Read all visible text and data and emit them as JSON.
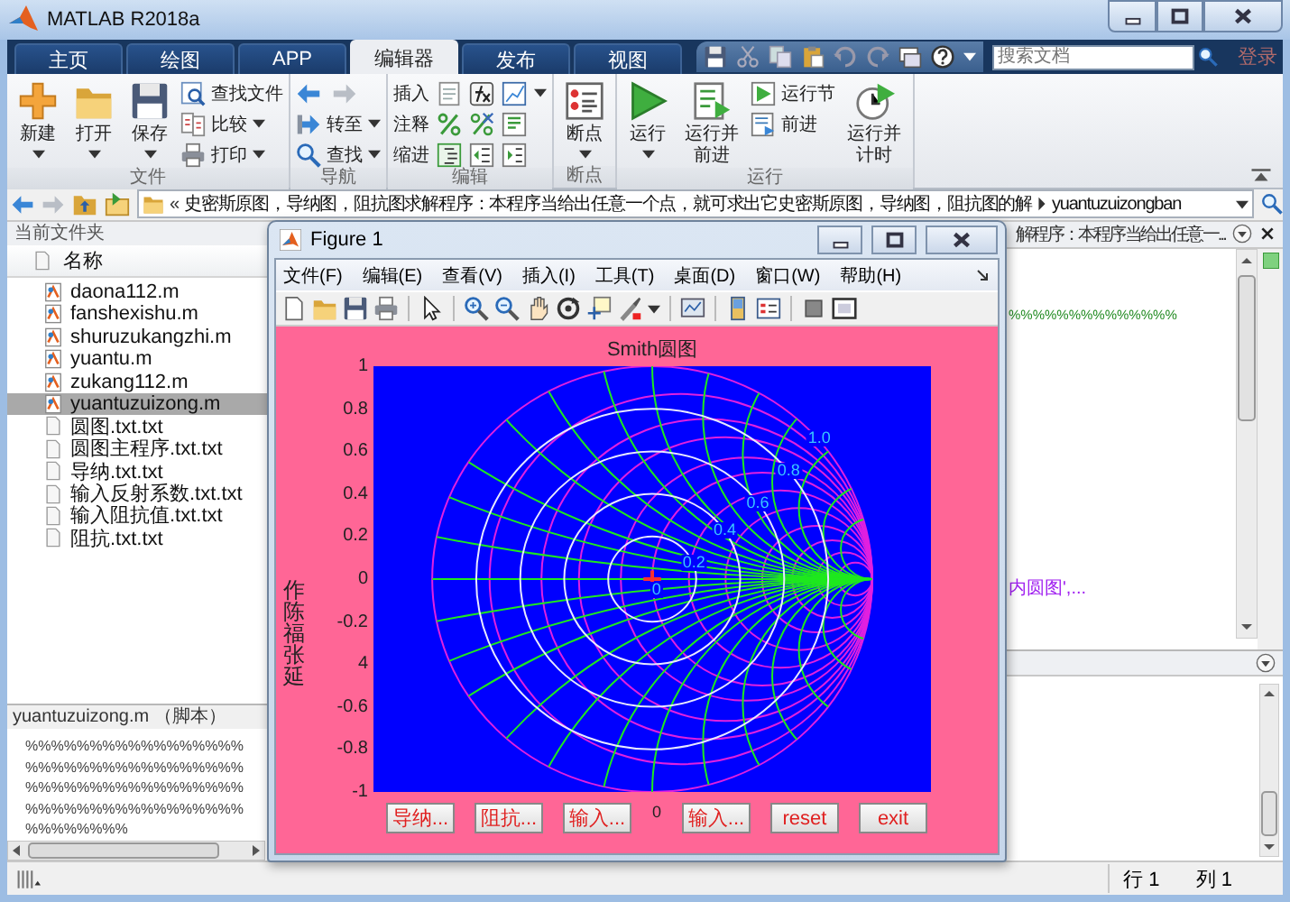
{
  "window": {
    "title": "MATLAB R2018a"
  },
  "tabs": [
    {
      "label": "主页",
      "selected": false
    },
    {
      "label": "绘图",
      "selected": false
    },
    {
      "label": "APP",
      "selected": false
    },
    {
      "label": "编辑器",
      "selected": true
    },
    {
      "label": "发布",
      "selected": false
    },
    {
      "label": "视图",
      "selected": false
    }
  ],
  "search": {
    "placeholder": "搜索文档"
  },
  "sign_in": "登录",
  "ribbon": {
    "groups": [
      {
        "label": "文件",
        "items": [
          {
            "kind": "large",
            "label": "新建",
            "dropdown": true
          },
          {
            "kind": "large",
            "label": "打开",
            "dropdown": true
          },
          {
            "kind": "large",
            "label": "保存",
            "dropdown": true
          },
          {
            "kind": "stack",
            "buttons": [
              {
                "kind": "small",
                "label": "查找文件",
                "dropdown": false
              },
              {
                "kind": "small",
                "label": "比较",
                "dropdown": true
              },
              {
                "kind": "small",
                "label": "打印",
                "dropdown": true
              }
            ]
          }
        ]
      },
      {
        "label": "导航",
        "items": [
          {
            "kind": "stack",
            "buttons": [
              {
                "kind": "arrows"
              },
              {
                "kind": "small",
                "label": "转至",
                "dropdown": true
              },
              {
                "kind": "small",
                "label": "查找",
                "dropdown": true
              }
            ]
          }
        ]
      },
      {
        "label": "编辑",
        "items": [
          {
            "kind": "stack",
            "buttons": [
              {
                "kind": "tools",
                "label": "插入"
              },
              {
                "kind": "tools",
                "label": "注释"
              },
              {
                "kind": "tools",
                "label": "缩进"
              }
            ]
          }
        ]
      },
      {
        "label": "断点",
        "items": [
          {
            "kind": "large",
            "label": "断点",
            "dropdown": true
          }
        ]
      },
      {
        "label": "运行",
        "items": [
          {
            "kind": "large",
            "label": "运行",
            "dropdown": true
          },
          {
            "kind": "large",
            "label": "运行并前进",
            "dropdown": false
          },
          {
            "kind": "stack",
            "buttons": [
              {
                "kind": "small",
                "label": "运行节",
                "dropdown": false
              },
              {
                "kind": "small",
                "label": "前进",
                "dropdown": false
              }
            ]
          },
          {
            "kind": "large",
            "label": "运行并计时",
            "dropdown": false
          }
        ]
      }
    ]
  },
  "address_bar": {
    "prefix": "«",
    "path": "史密斯原图，导纳图，阻抗图求解程序：本程序当给出任意一个点，就可求出它史密斯原图，导纳图，阻抗图的解",
    "folder": "yuantuzuizongban"
  },
  "current_folder": {
    "title": "当前文件夹",
    "column": "名称",
    "files": [
      {
        "name": "daona112.m",
        "kind": "m",
        "selected": false
      },
      {
        "name": "fanshexishu.m",
        "kind": "m",
        "selected": false
      },
      {
        "name": "shuruzukangzhi.m",
        "kind": "m",
        "selected": false
      },
      {
        "name": "yuantu.m",
        "kind": "m",
        "selected": false
      },
      {
        "name": "zukang112.m",
        "kind": "m",
        "selected": false
      },
      {
        "name": "yuantuzuizong.m",
        "kind": "m",
        "selected": true
      },
      {
        "name": "圆图.txt.txt",
        "kind": "txt",
        "selected": false
      },
      {
        "name": "圆图主程序.txt.txt",
        "kind": "txt",
        "selected": false
      },
      {
        "name": "导纳.txt.txt",
        "kind": "txt",
        "selected": false
      },
      {
        "name": "输入反射系数.txt.txt",
        "kind": "txt",
        "selected": false
      },
      {
        "name": "输入阻抗值.txt.txt",
        "kind": "txt",
        "selected": false
      },
      {
        "name": "阻抗.txt.txt",
        "kind": "txt",
        "selected": false
      }
    ],
    "details": {
      "title": "yuantuzuizong.m （脚本）",
      "lines": [
        "%%%%%%%%%%%%%%%%%",
        "%%%%%%%%%%%%%%%%%",
        "%%%%%%%%%%%%%%%%%",
        "%%%%%%%%%%%%%%%%%",
        "%%%%%%%%"
      ]
    }
  },
  "editor": {
    "title": "解程序：本程序当给出任意一...",
    "lines": [
      {
        "text": "%%%%%%%%%%%%%%",
        "kind": "comment"
      },
      {
        "text": "内圆图',...",
        "kind": "string"
      }
    ]
  },
  "figure": {
    "title": "Figure 1",
    "menu": [
      "文件(F)",
      "编辑(E)",
      "查看(V)",
      "插入(I)",
      "工具(T)",
      "桌面(D)",
      "窗口(W)",
      "帮助(H)"
    ],
    "plot": {
      "title": "Smith圆图",
      "yticks": [
        "1",
        "0.8",
        "0.6",
        "0.4",
        "0.2",
        "0",
        "-0.2",
        "4",
        "-0.6",
        "-0.8",
        "-1"
      ],
      "x_tick": "0",
      "circle_labels": [
        "1.0",
        "0.8",
        "0.6",
        "0.4",
        "0.2",
        "0"
      ],
      "side_text": [
        "作",
        "陈福",
        "张延"
      ]
    },
    "buttons": [
      "导纳...",
      "阻抗...",
      "输入...",
      "输入...",
      "reset",
      "exit"
    ]
  },
  "status_bar": {
    "line": "行 1",
    "column": "列 1"
  }
}
